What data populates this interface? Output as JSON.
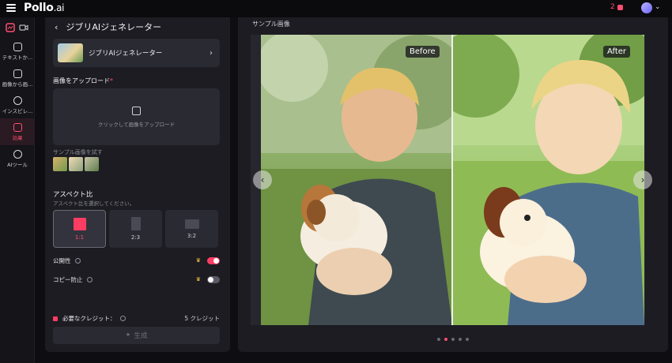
{
  "header": {
    "logo_main": "Pollo",
    "logo_suffix": ".ai",
    "credits_count": "2"
  },
  "sidebar": {
    "items": [
      {
        "label": "テキストか...",
        "icon": "text-to-video-icon"
      },
      {
        "label": "画像から画...",
        "icon": "image-to-image-icon"
      },
      {
        "label": "インスピレ...",
        "icon": "inspiration-icon"
      },
      {
        "label": "効果",
        "icon": "effects-icon"
      },
      {
        "label": "AIツール",
        "icon": "ai-tools-icon"
      }
    ]
  },
  "left_panel": {
    "back_title": "ジブリAIジェネレーター",
    "tool_card_label": "ジブリAIジェネレーター",
    "upload_label": "画像をアップロード",
    "upload_required": "*",
    "upload_prompt": "クリックして画像をアップロード",
    "sample_label": "サンプル画像を試す",
    "aspect_title": "アスペクト比",
    "aspect_sub": "アスペクト比を選択してください。",
    "aspects": [
      "1:1",
      "2:3",
      "3:2"
    ],
    "public_label": "公開性",
    "copy_protect_label": "コピー防止",
    "credit_label": "必要なクレジット：",
    "credit_value": "5 クレジット",
    "generate_label": "生成"
  },
  "right_panel": {
    "title": "サンプル画像",
    "before_tag": "Before",
    "after_tag": "After",
    "dots_active_index": 1
  },
  "colors": {
    "accent": "#ff3d62",
    "panel": "#1c1c22",
    "background": "#0e0e12"
  }
}
